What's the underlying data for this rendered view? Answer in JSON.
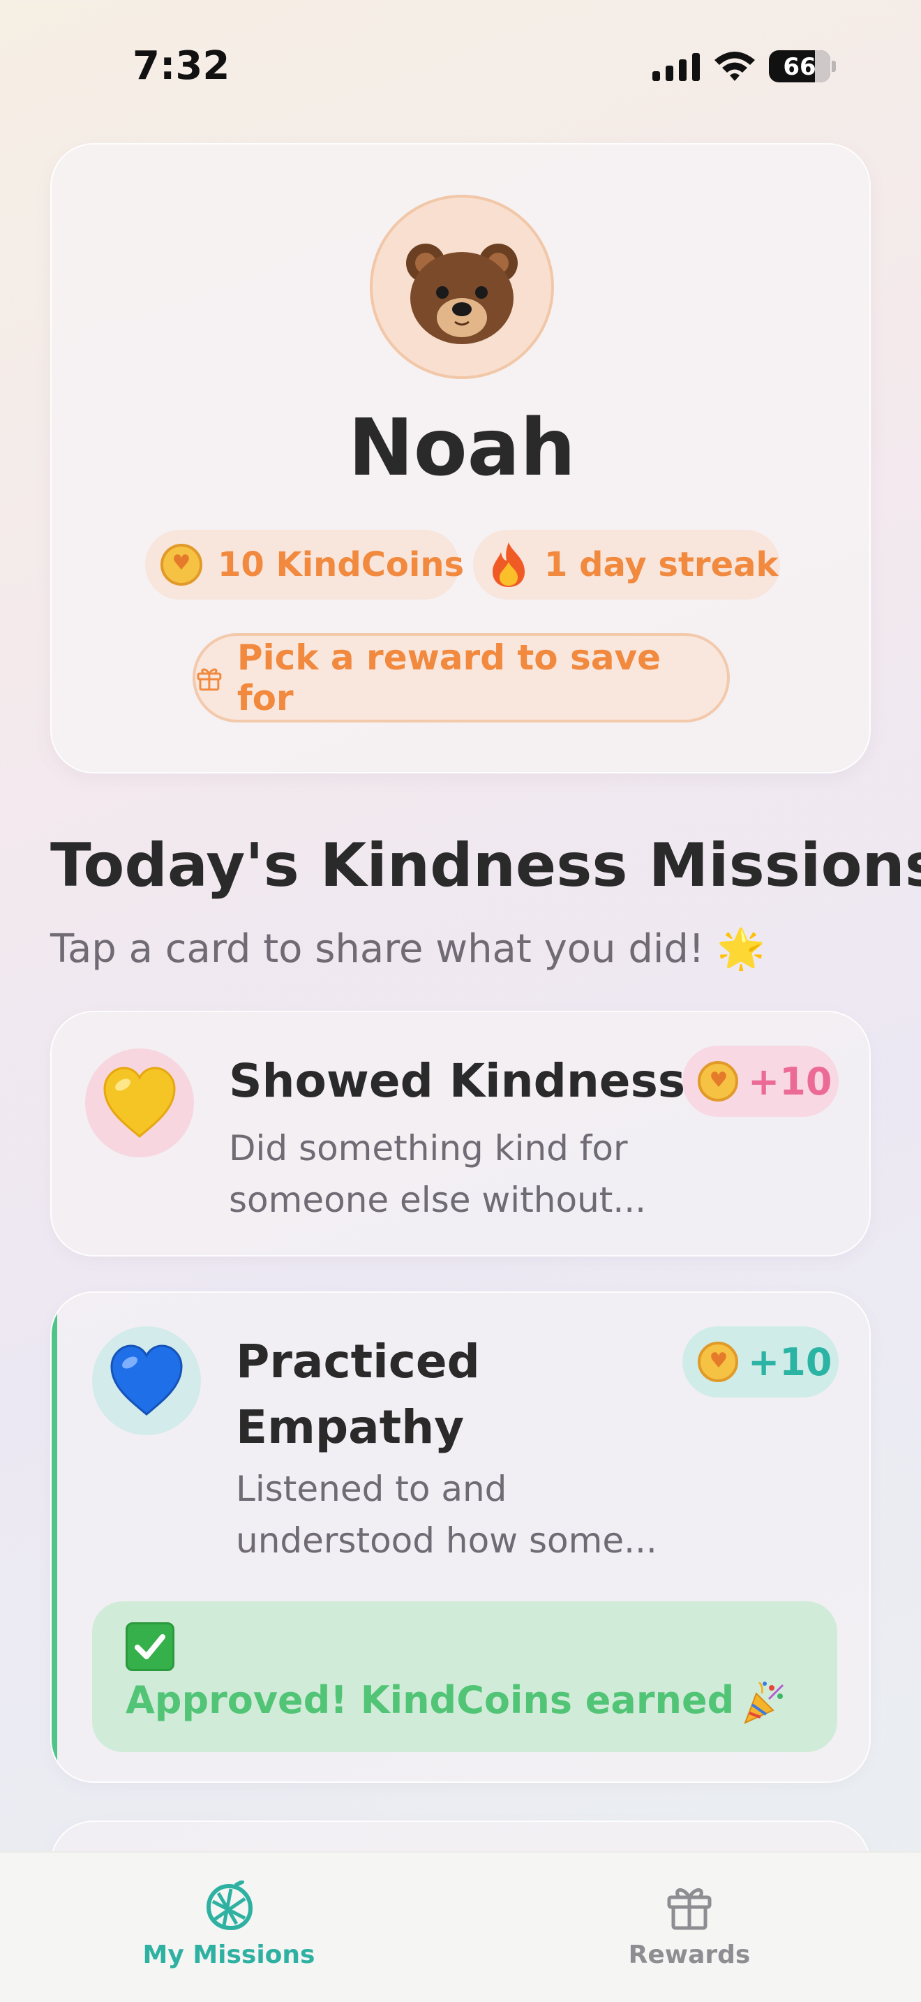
{
  "status_bar": {
    "time": "7:32",
    "battery": "66",
    "icons": [
      "signal-icon",
      "wifi-icon",
      "battery-icon"
    ]
  },
  "profile": {
    "avatar_icon": "bear-face-icon",
    "name": "Noah",
    "coins_label": "10 KindCoins",
    "streak_label": "1 day streak",
    "reward_button_label": "Pick a reward to save for"
  },
  "missions_section": {
    "title": "Today's Kindness Missions",
    "subtitle": "Tap a card to share what you did! 🌟",
    "cards": [
      {
        "icon": "yellow-heart-icon",
        "title": "Showed Kindness",
        "description": "Did something kind for someone else without...",
        "points": "+10",
        "status": ""
      },
      {
        "icon": "blue-heart-icon",
        "title": "Practiced Empathy",
        "description": "Listened to and understood how some...",
        "points": "+10",
        "status": "Approved! KindCoins earned"
      }
    ]
  },
  "tab_bar": {
    "tabs": [
      {
        "label": "My Missions",
        "icon": "hop-cone-icon",
        "active": true
      },
      {
        "label": "Rewards",
        "icon": "gift-icon",
        "active": false
      }
    ]
  },
  "colors": {
    "accent_orange": "#f1893e",
    "accent_teal": "#2fb1a2",
    "accent_pink": "#ec6b96",
    "approved_green": "#52c476"
  }
}
